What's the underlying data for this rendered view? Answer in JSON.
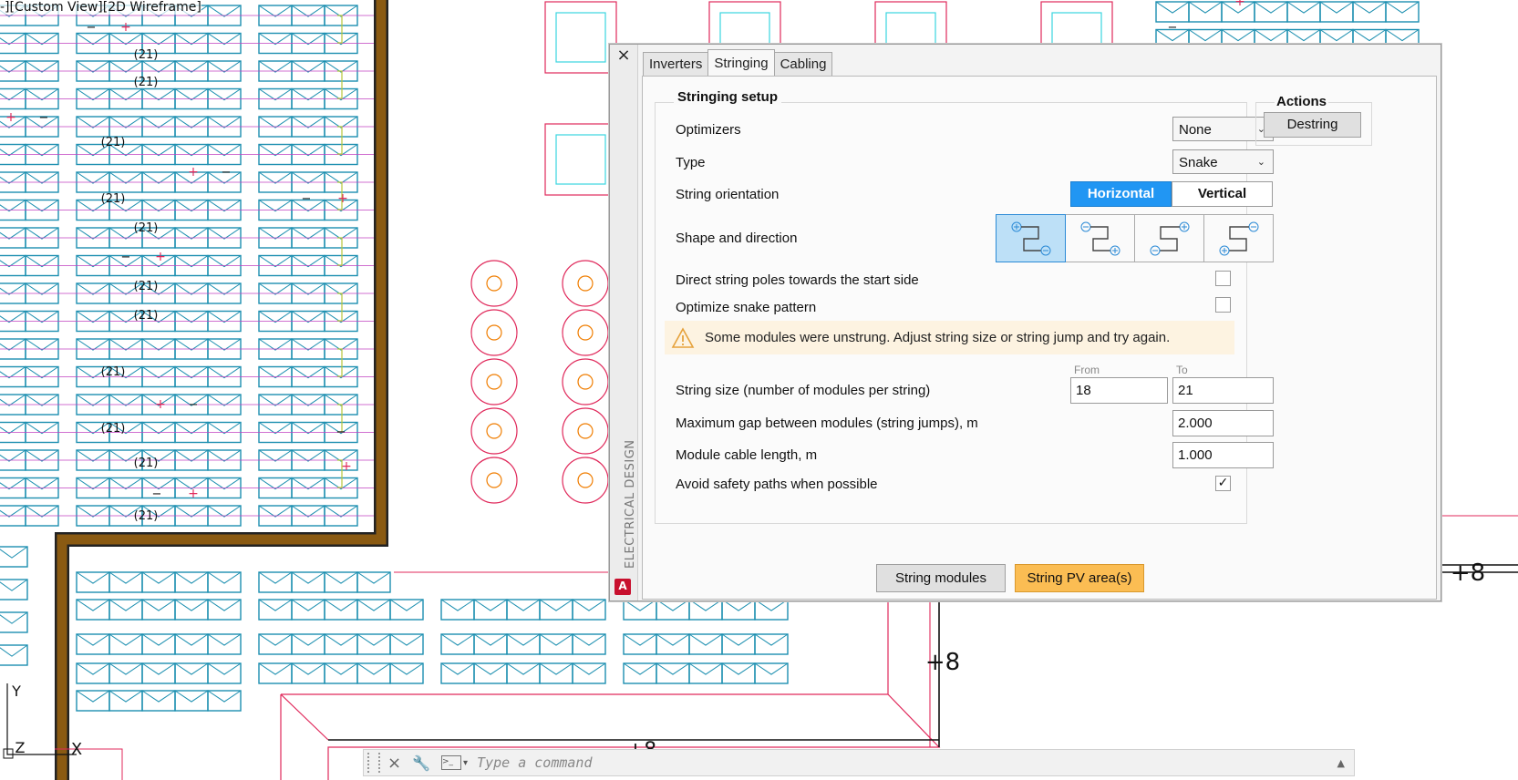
{
  "viewport": {
    "label": "-][Custom View][2D Wireframe]",
    "string_marker": "(21)",
    "elevation_labels": [
      "+8",
      "+8",
      "+8",
      "+8"
    ],
    "plus_sign": "+",
    "minus_sign": "−",
    "ucs_labels": [
      "Y",
      "Z",
      "X"
    ]
  },
  "colors": {
    "module": "#1c8fb0",
    "string_line": "#b7c53a",
    "boundary": "#e0295b",
    "wall": "#8a5a12",
    "accent_blue": "#2196f3",
    "accent_orange": "#fbbd53"
  },
  "palette": {
    "close": "×",
    "side_title": "ELECTRICAL DESIGN",
    "logo": "A",
    "tabs": [
      {
        "label": "Inverters",
        "active": false
      },
      {
        "label": "Stringing",
        "active": true
      },
      {
        "label": "Cabling",
        "active": false
      }
    ],
    "setup": {
      "title": "Stringing setup",
      "optimizers": {
        "label": "Optimizers",
        "value": "None"
      },
      "type": {
        "label": "Type",
        "value": "Snake"
      },
      "orientation": {
        "label": "String orientation",
        "options": [
          "Horizontal",
          "Vertical"
        ],
        "selected": "Horizontal"
      },
      "shape": {
        "label": "Shape and direction",
        "selected_index": 0
      },
      "direct_poles": {
        "label": "Direct string poles towards the start side",
        "checked": false
      },
      "optimize_snake": {
        "label": "Optimize snake pattern",
        "checked": false
      },
      "warning": "Some modules were unstrung. Adjust string size or string jump and try again.",
      "from_label": "From",
      "to_label": "To",
      "string_size": {
        "label": "String size (number of modules per string)",
        "from": "18",
        "to": "21"
      },
      "max_gap": {
        "label": "Maximum gap between modules (string jumps), m",
        "value": "2.000"
      },
      "cable_length": {
        "label": "Module cable length, m",
        "value": "1.000"
      },
      "avoid_paths": {
        "label": "Avoid safety paths when possible",
        "checked": true,
        "mark": "✓"
      }
    },
    "actions": {
      "title": "Actions",
      "destring": "Destring"
    },
    "buttons": {
      "string_modules": "String modules",
      "string_pv_areas": "String PV area(s)"
    }
  },
  "command_line": {
    "placeholder": "Type a command",
    "close": "×",
    "wrench": "🔧",
    "prompt_icon": ">_",
    "dropdown": "▾",
    "history": "▲"
  }
}
